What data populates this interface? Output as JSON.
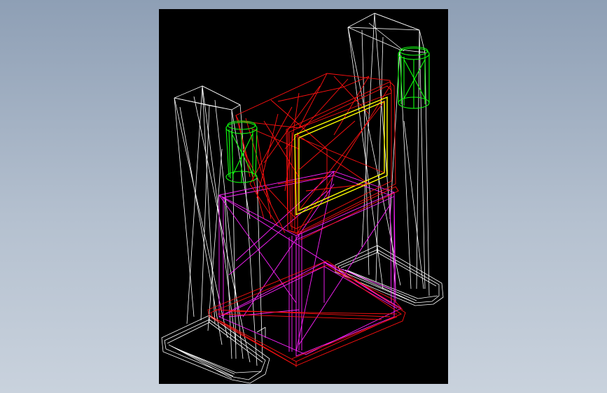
{
  "viewport": {
    "background": "#000000",
    "render_mode": "wireframe"
  },
  "colors": {
    "speaker_frames": "#ffffff",
    "tv_body": "#ff1010",
    "tv_stand": "#ff20ff",
    "speaker_drivers": "#10ff10",
    "screen_bezel": "#ffff00"
  },
  "objects": [
    {
      "name": "left-tower-speaker",
      "color": "#ffffff"
    },
    {
      "name": "right-tower-speaker",
      "color": "#ffffff"
    },
    {
      "name": "crt-television",
      "color": "#ff1010"
    },
    {
      "name": "screen",
      "color": "#ffff00"
    },
    {
      "name": "tv-stand",
      "color": "#ff20ff"
    },
    {
      "name": "left-speaker-driver",
      "color": "#10ff10"
    },
    {
      "name": "right-speaker-driver",
      "color": "#10ff10"
    }
  ]
}
